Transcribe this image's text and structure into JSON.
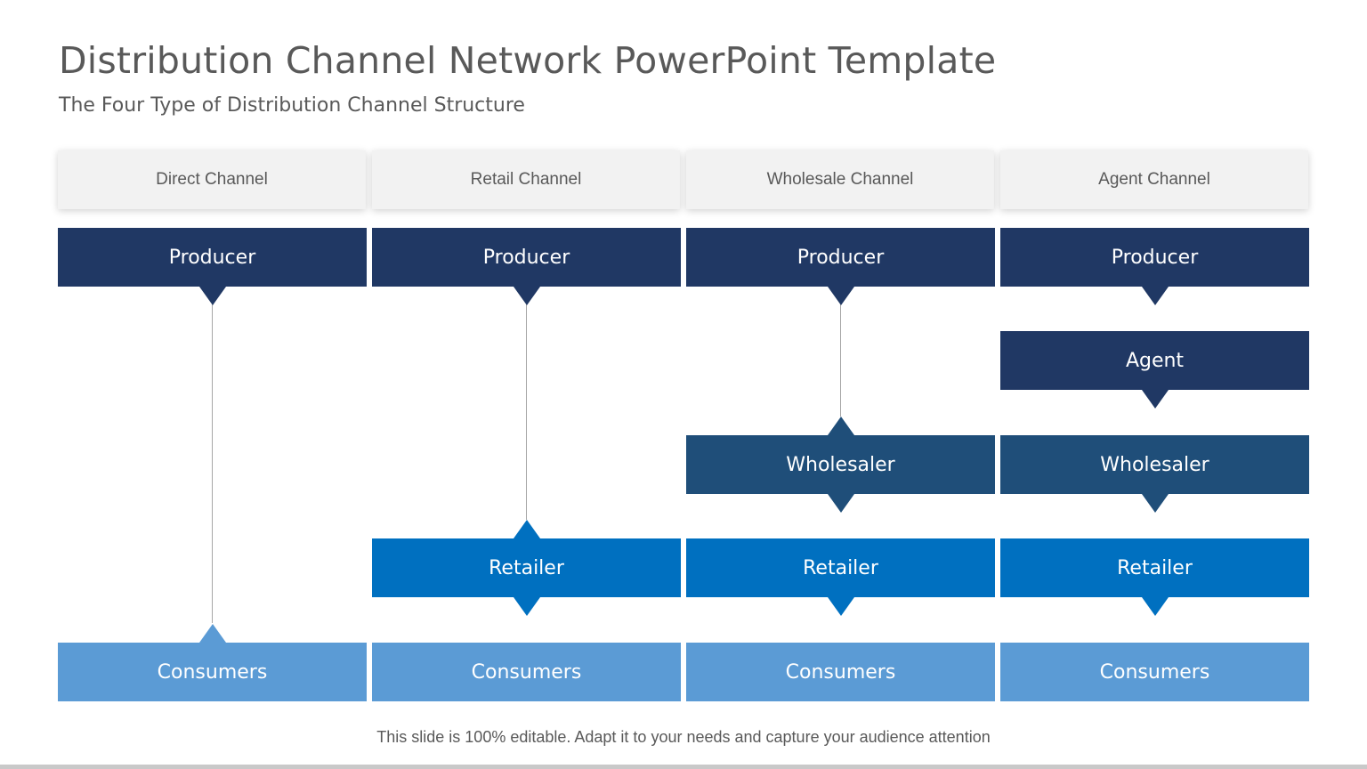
{
  "title": "Distribution Channel Network PowerPoint Template",
  "subtitle": "The Four Type of Distribution  Channel Structure",
  "footer": "This slide is 100% editable. Adapt it to your needs and capture your audience attention",
  "colors": {
    "producer": "#203864",
    "agent": "#203864",
    "wholesaler": "#1f4e79",
    "retailer": "#0070c0",
    "consumers": "#5b9bd5",
    "header_bg": "#f2f2f2"
  },
  "channels": [
    {
      "name": "Direct Channel",
      "steps": [
        "Producer",
        "Consumers"
      ]
    },
    {
      "name": "Retail Channel",
      "steps": [
        "Producer",
        "Retailer",
        "Consumers"
      ]
    },
    {
      "name": "Wholesale Channel",
      "steps": [
        "Producer",
        "Wholesaler",
        "Retailer",
        "Consumers"
      ]
    },
    {
      "name": "Agent Channel",
      "steps": [
        "Producer",
        "Agent",
        "Wholesaler",
        "Retailer",
        "Consumers"
      ]
    }
  ]
}
